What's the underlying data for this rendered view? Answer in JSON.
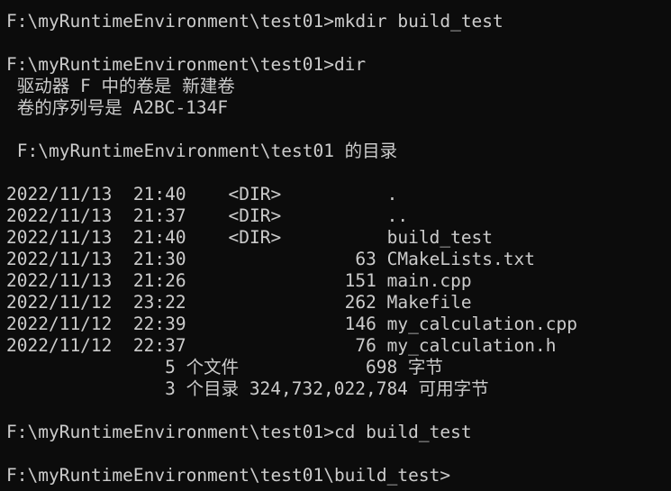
{
  "terminal": {
    "colors": {
      "background": "#0c0c0c",
      "foreground": "#cccccc"
    },
    "lines": [
      "F:\\myRuntimeEnvironment\\test01>mkdir build_test",
      "",
      "F:\\myRuntimeEnvironment\\test01>dir",
      " 驱动器 F 中的卷是 新建卷",
      " 卷的序列号是 A2BC-134F",
      "",
      " F:\\myRuntimeEnvironment\\test01 的目录",
      "",
      "2022/11/13  21:40    <DIR>          .",
      "2022/11/13  21:37    <DIR>          ..",
      "2022/11/13  21:40    <DIR>          build_test",
      "2022/11/13  21:30                63 CMakeLists.txt",
      "2022/11/13  21:26               151 main.cpp",
      "2022/11/12  23:22               262 Makefile",
      "2022/11/12  22:39               146 my_calculation.cpp",
      "2022/11/12  22:37                76 my_calculation.h",
      "               5 个文件            698 字节",
      "               3 个目录 324,732,022,784 可用字节",
      "",
      "F:\\myRuntimeEnvironment\\test01>cd build_test",
      "",
      "F:\\myRuntimeEnvironment\\test01\\build_test>"
    ]
  }
}
